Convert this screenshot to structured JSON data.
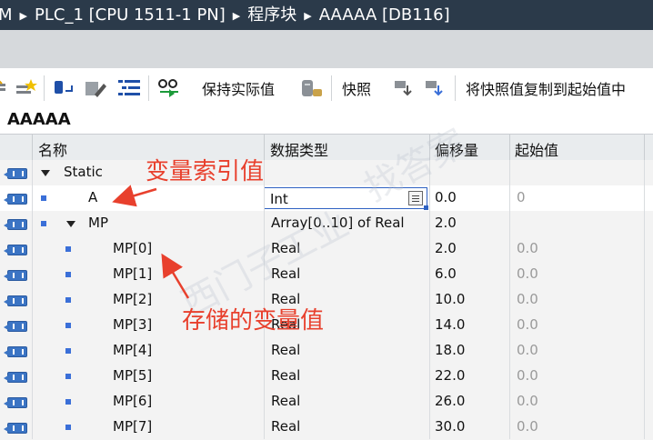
{
  "titlebar": {
    "crumbs": [
      "M",
      "PLC_1 [CPU 1511-1 PN]",
      "程序块",
      "AAAAA [DB116]"
    ]
  },
  "toolbar": {
    "keep_actual_label": "保持实际值",
    "snapshot_label": "快照",
    "copy_snapshot_label": "将快照值复制到起始值中"
  },
  "block": {
    "title": "AAAAA"
  },
  "columns": {
    "name": "名称",
    "datatype": "数据类型",
    "offset": "偏移量",
    "start": "起始值"
  },
  "rows": [
    {
      "name": "Static",
      "type": "",
      "offset": "",
      "start": ""
    },
    {
      "name": "A",
      "type": "Int",
      "offset": "0.0",
      "start": "0"
    },
    {
      "name": "MP",
      "type": "Array[0..10] of Real",
      "offset": "2.0",
      "start": ""
    },
    {
      "name": "MP[0]",
      "type": "Real",
      "offset": "2.0",
      "start": "0.0"
    },
    {
      "name": "MP[1]",
      "type": "Real",
      "offset": "6.0",
      "start": "0.0"
    },
    {
      "name": "MP[2]",
      "type": "Real",
      "offset": "10.0",
      "start": "0.0"
    },
    {
      "name": "MP[3]",
      "type": "Real",
      "offset": "14.0",
      "start": "0.0"
    },
    {
      "name": "MP[4]",
      "type": "Real",
      "offset": "18.0",
      "start": "0.0"
    },
    {
      "name": "MP[5]",
      "type": "Real",
      "offset": "22.0",
      "start": "0.0"
    },
    {
      "name": "MP[6]",
      "type": "Real",
      "offset": "26.0",
      "start": "0.0"
    },
    {
      "name": "MP[7]",
      "type": "Real",
      "offset": "30.0",
      "start": "0.0"
    }
  ],
  "annotations": {
    "index_label": "变量索引值",
    "stored_label": "存储的变量值"
  },
  "watermark": {
    "text_1": "西门子工业",
    "text_2": "找答案"
  },
  "colors": {
    "annotation": "#e8402d",
    "titlebar": "#2b3a4a",
    "accent": "#3a6fd8"
  }
}
